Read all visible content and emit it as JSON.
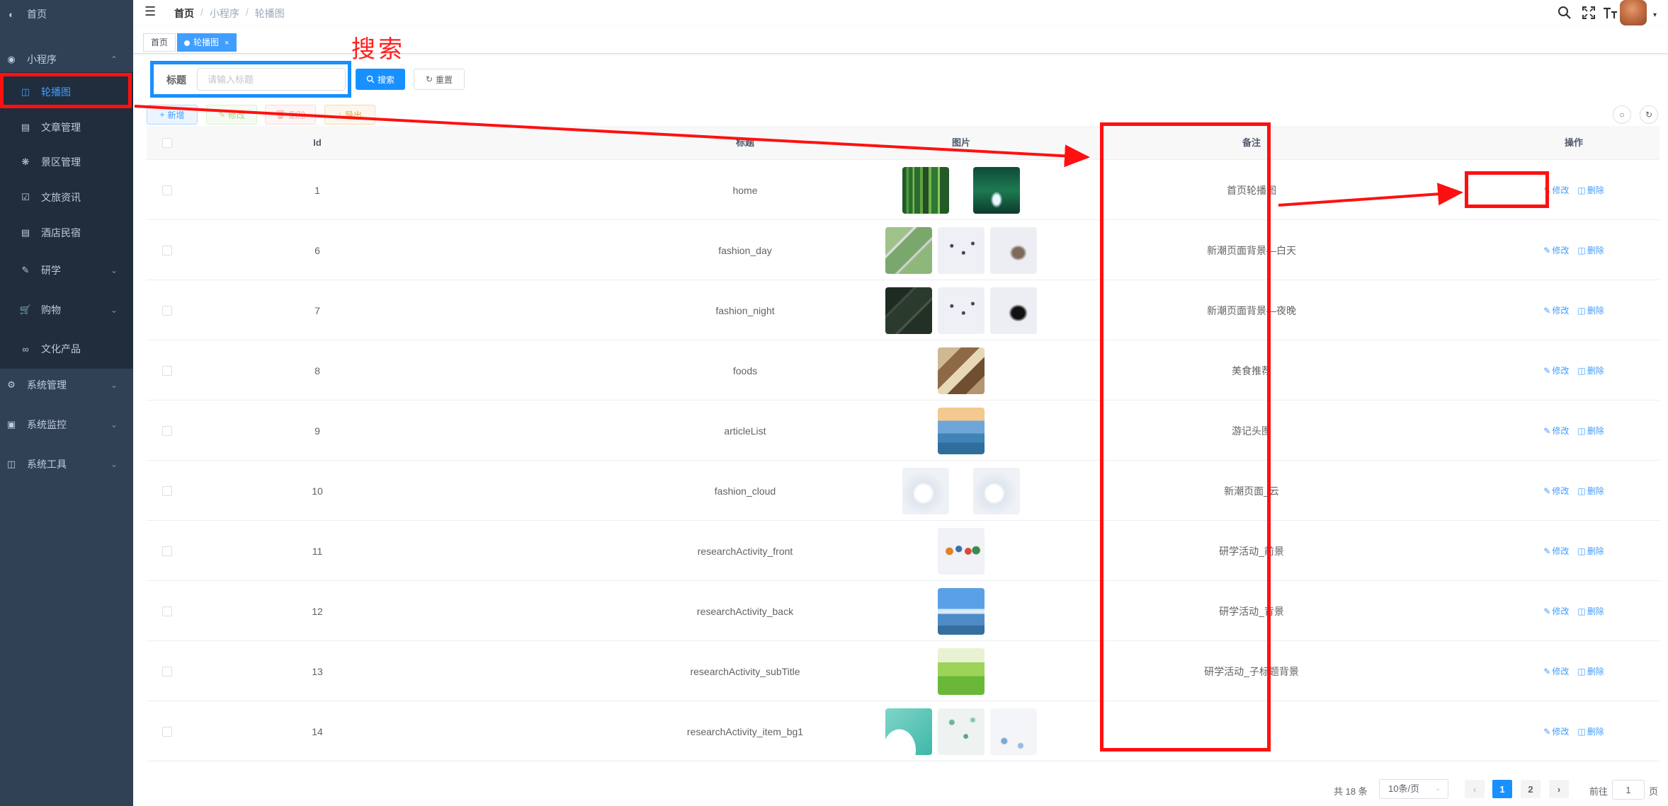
{
  "sidebar": {
    "items": [
      {
        "label": "首页",
        "icon": "dashboard-icon",
        "type": "top"
      },
      {
        "label": "小程序",
        "icon": "wechat-icon",
        "type": "top"
      },
      {
        "label": "轮播图",
        "icon": "swiper-icon",
        "type": "sub",
        "active": true
      },
      {
        "label": "文章管理",
        "icon": "article-icon",
        "type": "sub"
      },
      {
        "label": "景区管理",
        "icon": "scenic-icon",
        "type": "sub"
      },
      {
        "label": "文旅资讯",
        "icon": "news-icon",
        "type": "sub"
      },
      {
        "label": "酒店民宿",
        "icon": "hotel-icon",
        "type": "sub"
      },
      {
        "label": "研学",
        "icon": "study-icon",
        "type": "sub"
      },
      {
        "label": "购物",
        "icon": "cart-icon",
        "type": "sub"
      },
      {
        "label": "文化产品",
        "icon": "culture-icon",
        "type": "sub"
      },
      {
        "label": "系统管理",
        "icon": "settings-icon",
        "type": "top"
      },
      {
        "label": "系统监控",
        "icon": "monitor-icon",
        "type": "top"
      },
      {
        "label": "系统工具",
        "icon": "tools-icon",
        "type": "top"
      }
    ]
  },
  "header": {
    "breadcrumb": [
      "首页",
      "小程序",
      "轮播图"
    ]
  },
  "tags": {
    "home": "首页",
    "current": "轮播图",
    "close": "×"
  },
  "search": {
    "label": "标题",
    "placeholder": "请输入标题",
    "value": "",
    "search_btn": "搜索",
    "reset_btn": "重置"
  },
  "toolbar": {
    "add": "新增",
    "edit": "修改",
    "delete": "删除",
    "export": "导出"
  },
  "table": {
    "columns": [
      "Id",
      "标题",
      "图片",
      "备注",
      "操作"
    ],
    "rows": [
      {
        "id": "1",
        "title": "home",
        "remark": "首页轮播图",
        "images": [
          "bamboo",
          "waterfall"
        ]
      },
      {
        "id": "6",
        "title": "fashion_day",
        "remark": "新潮页面背景—白天",
        "images": [
          "map-day",
          "birds",
          "boats-day"
        ]
      },
      {
        "id": "7",
        "title": "fashion_night",
        "remark": "新潮页面背景—夜晚",
        "images": [
          "map-night",
          "birds",
          "boats-night"
        ]
      },
      {
        "id": "8",
        "title": "foods",
        "remark": "美食推荐",
        "images": [
          "food"
        ]
      },
      {
        "id": "9",
        "title": "articleList",
        "remark": "游记头图",
        "images": [
          "lake-tower"
        ]
      },
      {
        "id": "10",
        "title": "fashion_cloud",
        "remark": "新潮页面_云",
        "images": [
          "cloud",
          "cloud"
        ]
      },
      {
        "id": "11",
        "title": "researchActivity_front",
        "remark": "研学活动_前景",
        "images": [
          "kids"
        ]
      },
      {
        "id": "12",
        "title": "researchActivity_back",
        "remark": "研学活动_背景",
        "images": [
          "sky-lake"
        ]
      },
      {
        "id": "13",
        "title": "researchActivity_subTitle",
        "remark": "研学活动_子标题背景",
        "images": [
          "grass"
        ]
      },
      {
        "id": "14",
        "title": "researchActivity_item_bg1",
        "remark": "",
        "images": [
          "teal-wave",
          "leaves",
          "flowers"
        ]
      }
    ],
    "edit_label": "修改",
    "delete_label": "删除"
  },
  "pagination": {
    "total": "共 18 条",
    "page_size": "10条/页",
    "pages": [
      "1",
      "2"
    ],
    "current": "1",
    "goto_prefix": "前往",
    "goto_value": "1",
    "goto_suffix": "页"
  },
  "annotation": {
    "text": "搜索"
  },
  "colors": {
    "sidebar_bg": "#304156",
    "primary": "#1890ff",
    "annotation_red": "#ff1010",
    "annotation_blue": "#1890ff"
  }
}
